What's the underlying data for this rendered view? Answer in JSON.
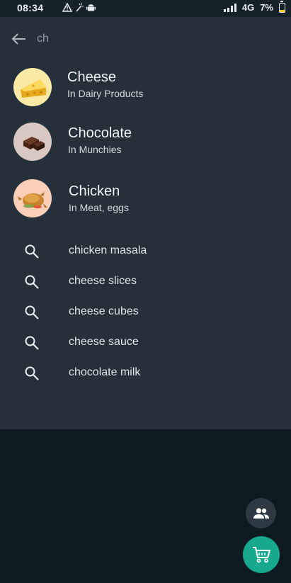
{
  "status_bar": {
    "time": "08:34",
    "network": "4G",
    "battery": "7%"
  },
  "search": {
    "query": "ch",
    "back_icon": "arrow-left-icon"
  },
  "products": [
    {
      "name": "Cheese",
      "category": "In Dairy Products",
      "icon": "cheese-image"
    },
    {
      "name": "Chocolate",
      "category": "In Munchies",
      "icon": "chocolate-image"
    },
    {
      "name": "Chicken",
      "category": "In Meat, eggs",
      "icon": "chicken-image"
    }
  ],
  "suggestions": [
    "chicken masala",
    "cheese slices",
    "cheese cubes",
    "cheese sauce",
    "chocolate milk"
  ],
  "fab": {
    "people_icon": "people-icon",
    "cart_icon": "cart-icon"
  },
  "colors": {
    "panel_bg": "#25303a",
    "screen_bg": "#0e1a21",
    "accent": "#17a98e",
    "cheese_bg": "#fbe9a6",
    "chocolate_bg": "#d9c8c2",
    "chicken_bg": "#fbcfb7"
  }
}
